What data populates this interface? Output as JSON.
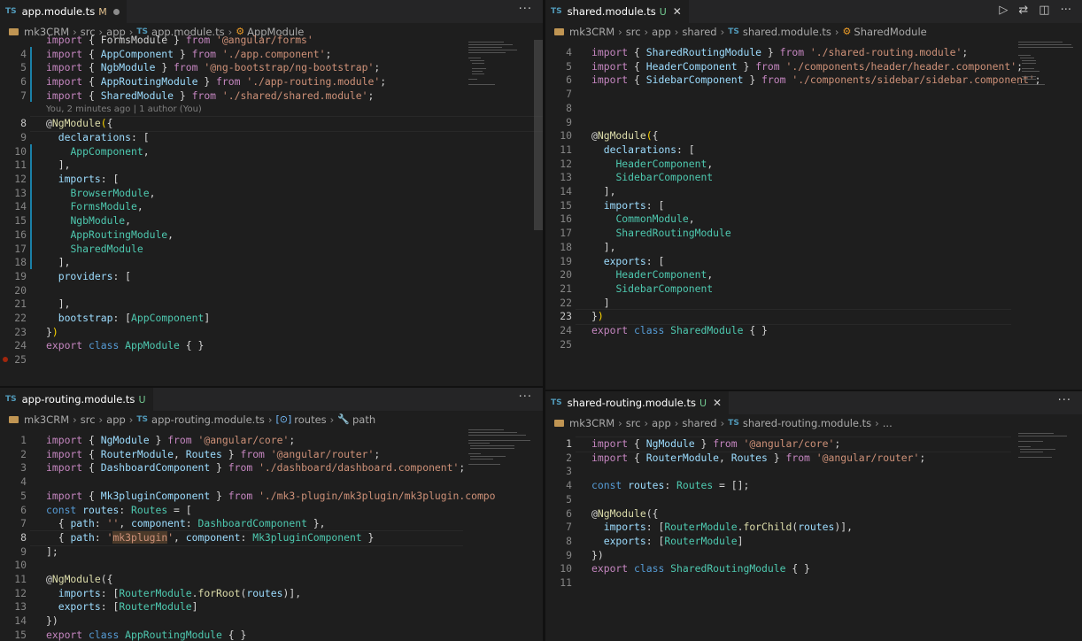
{
  "panes": {
    "app_module": {
      "tab": {
        "icon": "TS",
        "filename": "app.module.ts",
        "status": "M"
      },
      "more": "···",
      "breadcrumb": [
        "mk3CRM",
        "src",
        "app",
        "app.module.ts",
        "AppModule"
      ],
      "blame": "You, 2 minutes ago | 1 author (You)",
      "lines": [
        {
          "n": "",
          "html": "<span class=\"ctrl\">import</span> { FormsModule } <span class=\"ctrl\">from</span> <span class=\"str\">'@angular/forms'</span>"
        },
        {
          "n": "4",
          "html": "<span class=\"ctrl\">import</span> { <span class=\"var\">AppComponent</span> } <span class=\"ctrl\">from</span> <span class=\"str\">'./app.component'</span>;"
        },
        {
          "n": "5",
          "html": "<span class=\"ctrl\">import</span> { <span class=\"var\">NgbModule</span> } <span class=\"ctrl\">from</span> <span class=\"str\">'@ng-bootstrap/ng-bootstrap'</span>;"
        },
        {
          "n": "6",
          "html": "<span class=\"ctrl\">import</span> { <span class=\"var\">AppRoutingModule</span> } <span class=\"ctrl\">from</span> <span class=\"str\">'./app-routing.module'</span>;"
        },
        {
          "n": "7",
          "html": "<span class=\"ctrl\">import</span> { <span class=\"var\">SharedModule</span> } <span class=\"ctrl\">from</span> <span class=\"str\">'./shared/shared.module'</span>;"
        },
        {
          "n": "",
          "blame": true
        },
        {
          "n": "8",
          "html": "@<span class=\"fn\">NgModule</span><span class=\"brk\">(</span>{",
          "cur": true
        },
        {
          "n": "9",
          "html": "  <span class=\"var\">declarations</span>: ["
        },
        {
          "n": "10",
          "html": "    <span class=\"typ\">AppComponent</span>,"
        },
        {
          "n": "11",
          "html": "  ],"
        },
        {
          "n": "12",
          "html": "  <span class=\"var\">imports</span>: ["
        },
        {
          "n": "13",
          "html": "    <span class=\"typ\">BrowserModule</span>,"
        },
        {
          "n": "14",
          "html": "    <span class=\"typ\">FormsModule</span>,"
        },
        {
          "n": "15",
          "html": "    <span class=\"typ\">NgbModule</span>,"
        },
        {
          "n": "16",
          "html": "    <span class=\"typ\">AppRoutingModule</span>,"
        },
        {
          "n": "17",
          "html": "    <span class=\"typ\">SharedModule</span>"
        },
        {
          "n": "18",
          "html": "  ],"
        },
        {
          "n": "19",
          "html": "  <span class=\"var\">providers</span>: ["
        },
        {
          "n": "20",
          "html": ""
        },
        {
          "n": "21",
          "html": "  ],"
        },
        {
          "n": "22",
          "html": "  <span class=\"var\">bootstrap</span>: [<span class=\"typ\">AppComponent</span>]"
        },
        {
          "n": "23",
          "html": "}<span class=\"brk\">)</span>"
        },
        {
          "n": "24",
          "html": "<span class=\"ctrl\">export</span> <span class=\"kw\">class</span> <span class=\"typ\">AppModule</span> { }"
        },
        {
          "n": "25",
          "html": ""
        }
      ]
    },
    "shared_module": {
      "tab": {
        "icon": "TS",
        "filename": "shared.module.ts",
        "status": "U"
      },
      "breadcrumb": [
        "mk3CRM",
        "src",
        "app",
        "shared",
        "shared.module.ts",
        "SharedModule"
      ],
      "lines": [
        {
          "n": "4",
          "html": "<span class=\"ctrl\">import</span> { <span class=\"var\">SharedRoutingModule</span> } <span class=\"ctrl\">from</span> <span class=\"str\">'./shared-routing.module'</span>;"
        },
        {
          "n": "5",
          "html": "<span class=\"ctrl\">import</span> { <span class=\"var\">HeaderComponent</span> } <span class=\"ctrl\">from</span> <span class=\"str\">'./components/header/header.component'</span>;"
        },
        {
          "n": "6",
          "html": "<span class=\"ctrl\">import</span> { <span class=\"var\">SidebarComponent</span> } <span class=\"ctrl\">from</span> <span class=\"str\">'./components/sidebar/sidebar.component'</span>;"
        },
        {
          "n": "7",
          "html": ""
        },
        {
          "n": "8",
          "html": ""
        },
        {
          "n": "9",
          "html": ""
        },
        {
          "n": "10",
          "html": "@<span class=\"fn\">NgModule</span><span class=\"brk\">(</span>{"
        },
        {
          "n": "11",
          "html": "  <span class=\"var\">declarations</span>: ["
        },
        {
          "n": "12",
          "html": "    <span class=\"typ\">HeaderComponent</span>,"
        },
        {
          "n": "13",
          "html": "    <span class=\"typ\">SidebarComponent</span>"
        },
        {
          "n": "14",
          "html": "  ],"
        },
        {
          "n": "15",
          "html": "  <span class=\"var\">imports</span>: ["
        },
        {
          "n": "16",
          "html": "    <span class=\"typ\">CommonModule</span>,"
        },
        {
          "n": "17",
          "html": "    <span class=\"typ\">SharedRoutingModule</span>"
        },
        {
          "n": "18",
          "html": "  ],"
        },
        {
          "n": "19",
          "html": "  <span class=\"var\">exports</span>: ["
        },
        {
          "n": "20",
          "html": "    <span class=\"typ\">HeaderComponent</span>,"
        },
        {
          "n": "21",
          "html": "    <span class=\"typ\">SidebarComponent</span>"
        },
        {
          "n": "22",
          "html": "  ]"
        },
        {
          "n": "23",
          "html": "}<span class=\"brk\">)</span>",
          "cur": true
        },
        {
          "n": "24",
          "html": "<span class=\"ctrl\">export</span> <span class=\"kw\">class</span> <span class=\"typ\">SharedModule</span> { }"
        },
        {
          "n": "25",
          "html": ""
        }
      ]
    },
    "app_routing": {
      "tab": {
        "icon": "TS",
        "filename": "app-routing.module.ts",
        "status": "U"
      },
      "more": "···",
      "breadcrumb": [
        "mk3CRM",
        "src",
        "app",
        "app-routing.module.ts",
        "routes",
        "path"
      ],
      "lines": [
        {
          "n": "1",
          "html": "<span class=\"ctrl\">import</span> { <span class=\"var\">NgModule</span> } <span class=\"ctrl\">from</span> <span class=\"str\">'@angular/core'</span>;"
        },
        {
          "n": "2",
          "html": "<span class=\"ctrl\">import</span> { <span class=\"var\">RouterModule</span>, <span class=\"var\">Routes</span> } <span class=\"ctrl\">from</span> <span class=\"str\">'@angular/router'</span>;"
        },
        {
          "n": "3",
          "html": "<span class=\"ctrl\">import</span> { <span class=\"var\">DashboardComponent</span> } <span class=\"ctrl\">from</span> <span class=\"str\">'./dashboard/dashboard.component'</span>;"
        },
        {
          "n": "4",
          "html": ""
        },
        {
          "n": "5",
          "html": "<span class=\"ctrl\">import</span> { <span class=\"var\">Mk3pluginComponent</span> } <span class=\"ctrl\">from</span> <span class=\"str\">'./mk3-plugin/mk3plugin/mk3plugin.compo</span>"
        },
        {
          "n": "6",
          "html": "<span class=\"kw\">const</span> <span class=\"var\">routes</span>: <span class=\"typ\">Routes</span> = ["
        },
        {
          "n": "7",
          "html": "  { <span class=\"var\">path</span>: <span class=\"str\">''</span>, <span class=\"var\">component</span>: <span class=\"typ\">DashboardComponent</span> },"
        },
        {
          "n": "8",
          "html": "  { <span class=\"var\">path</span>: <span class=\"str\">'</span><span class=\"strhl\">mk3plugin</span><span class=\"str\">'</span>, <span class=\"var\">component</span>: <span class=\"typ\">Mk3pluginComponent</span> }",
          "cur": true
        },
        {
          "n": "9",
          "html": "];"
        },
        {
          "n": "10",
          "html": ""
        },
        {
          "n": "11",
          "html": "@<span class=\"fn\">NgModule</span>({"
        },
        {
          "n": "12",
          "html": "  <span class=\"var\">imports</span>: [<span class=\"typ\">RouterModule</span>.<span class=\"fn\">forRoot</span>(<span class=\"var\">routes</span>)],"
        },
        {
          "n": "13",
          "html": "  <span class=\"var\">exports</span>: [<span class=\"typ\">RouterModule</span>]"
        },
        {
          "n": "14",
          "html": "})"
        },
        {
          "n": "15",
          "html": "<span class=\"ctrl\">export</span> <span class=\"kw\">class</span> <span class=\"typ\">AppRoutingModule</span> { }"
        }
      ]
    },
    "shared_routing": {
      "tab": {
        "icon": "TS",
        "filename": "shared-routing.module.ts",
        "status": "U"
      },
      "more": "···",
      "breadcrumb": [
        "mk3CRM",
        "src",
        "app",
        "shared",
        "shared-routing.module.ts",
        "..."
      ],
      "lines": [
        {
          "n": "1",
          "html": "<span class=\"ctrl\">import</span> { <span class=\"var\">NgModule</span> } <span class=\"ctrl\">from</span> <span class=\"str\">'@angular/core'</span>;",
          "cur": true
        },
        {
          "n": "2",
          "html": "<span class=\"ctrl\">import</span> { <span class=\"var\">RouterModule</span>, <span class=\"var\">Routes</span> } <span class=\"ctrl\">from</span> <span class=\"str\">'@angular/router'</span>;"
        },
        {
          "n": "3",
          "html": ""
        },
        {
          "n": "4",
          "html": "<span class=\"kw\">const</span> <span class=\"var\">routes</span>: <span class=\"typ\">Routes</span> = [];"
        },
        {
          "n": "5",
          "html": ""
        },
        {
          "n": "6",
          "html": "@<span class=\"fn\">NgModule</span>({"
        },
        {
          "n": "7",
          "html": "  <span class=\"var\">imports</span>: [<span class=\"typ\">RouterModule</span>.<span class=\"fn\">forChild</span>(<span class=\"var\">routes</span>)],"
        },
        {
          "n": "8",
          "html": "  <span class=\"var\">exports</span>: [<span class=\"typ\">RouterModule</span>]"
        },
        {
          "n": "9",
          "html": "})"
        },
        {
          "n": "10",
          "html": "<span class=\"ctrl\">export</span> <span class=\"kw\">class</span> <span class=\"typ\">SharedRoutingModule</span> { }"
        },
        {
          "n": "11",
          "html": ""
        }
      ]
    }
  },
  "colors": {
    "accent": "#1b81a8",
    "ts_icon": "#519aba",
    "modified": "#e2c08d",
    "untracked": "#73c991"
  },
  "icons": {
    "run": "play-icon",
    "compare": "compare-changes-icon",
    "split": "split-editor-icon",
    "more": "ellipsis-icon"
  }
}
